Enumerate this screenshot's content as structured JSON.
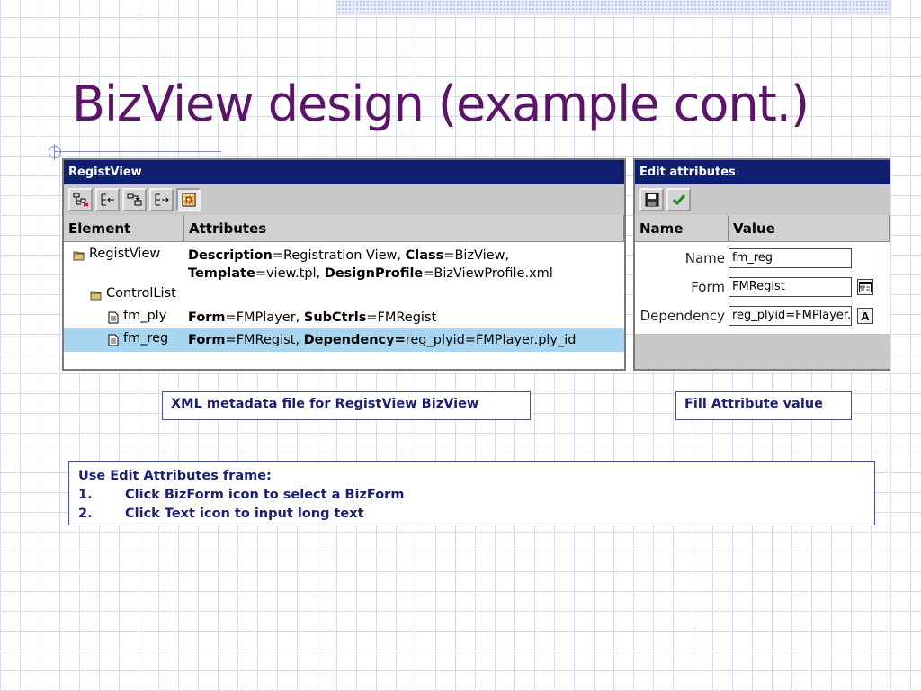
{
  "slide": {
    "title": "BizView design (example cont.)"
  },
  "regist_view": {
    "window_title": "RegistView",
    "toolbar_icons": [
      "tree-add-icon",
      "indent-icon",
      "move-down-icon",
      "move-right-icon",
      "grid-icon"
    ],
    "columns": {
      "element": "Element",
      "attributes": "Attributes"
    },
    "rows": [
      {
        "element": "RegistView",
        "icon": "folder-icon",
        "attr_parts": [
          {
            "k": "Description",
            "v": "=Registration View, "
          },
          {
            "k": "Class",
            "v": "=BizView,"
          },
          {
            "k": "Template",
            "v": "=view.tpl, "
          },
          {
            "k": "DesignProfile",
            "v": "=BizViewProfile.xml"
          }
        ]
      },
      {
        "element": "ControlList",
        "icon": "folder-icon",
        "attr_parts": []
      },
      {
        "element": "fm_ply",
        "icon": "document-icon",
        "attr_parts": [
          {
            "k": "Form",
            "v": "=FMPlayer, "
          },
          {
            "k": "SubCtrls",
            "v": "=FMRegist"
          }
        ]
      },
      {
        "element": "fm_reg",
        "icon": "document-icon",
        "selected": true,
        "attr_parts": [
          {
            "k": "Form",
            "v": "=FMRegist, "
          },
          {
            "k": "Dependency=",
            "v": "reg_plyid=FMPlayer.ply_id"
          }
        ]
      }
    ]
  },
  "edit_attributes": {
    "window_title": "Edit attributes",
    "toolbar_icons": [
      "save-icon",
      "check-icon"
    ],
    "columns": {
      "name": "Name",
      "value": "Value"
    },
    "fields": [
      {
        "label": "Name",
        "value": "fm_reg",
        "button": null
      },
      {
        "label": "Form",
        "value": "FMRegist",
        "button": "bizform-picker-icon"
      },
      {
        "label": "Dependency",
        "value": "reg_plyid=FMPlayer.p",
        "button": "A"
      }
    ]
  },
  "captions": {
    "left": "XML metadata file for RegistView BizView",
    "right": "Fill Attribute value"
  },
  "instructions": {
    "heading": "Use Edit Attributes frame:",
    "steps": [
      {
        "num": "1.",
        "text": "Click BizForm icon to select a BizForm"
      },
      {
        "num": "2.",
        "text": "Click Text icon to input long text"
      }
    ]
  },
  "colors": {
    "title": "#5b1468",
    "window_titlebar": "#0d1f6e",
    "selection": "#a8d6f0",
    "caption_text": "#1a1f6e"
  }
}
